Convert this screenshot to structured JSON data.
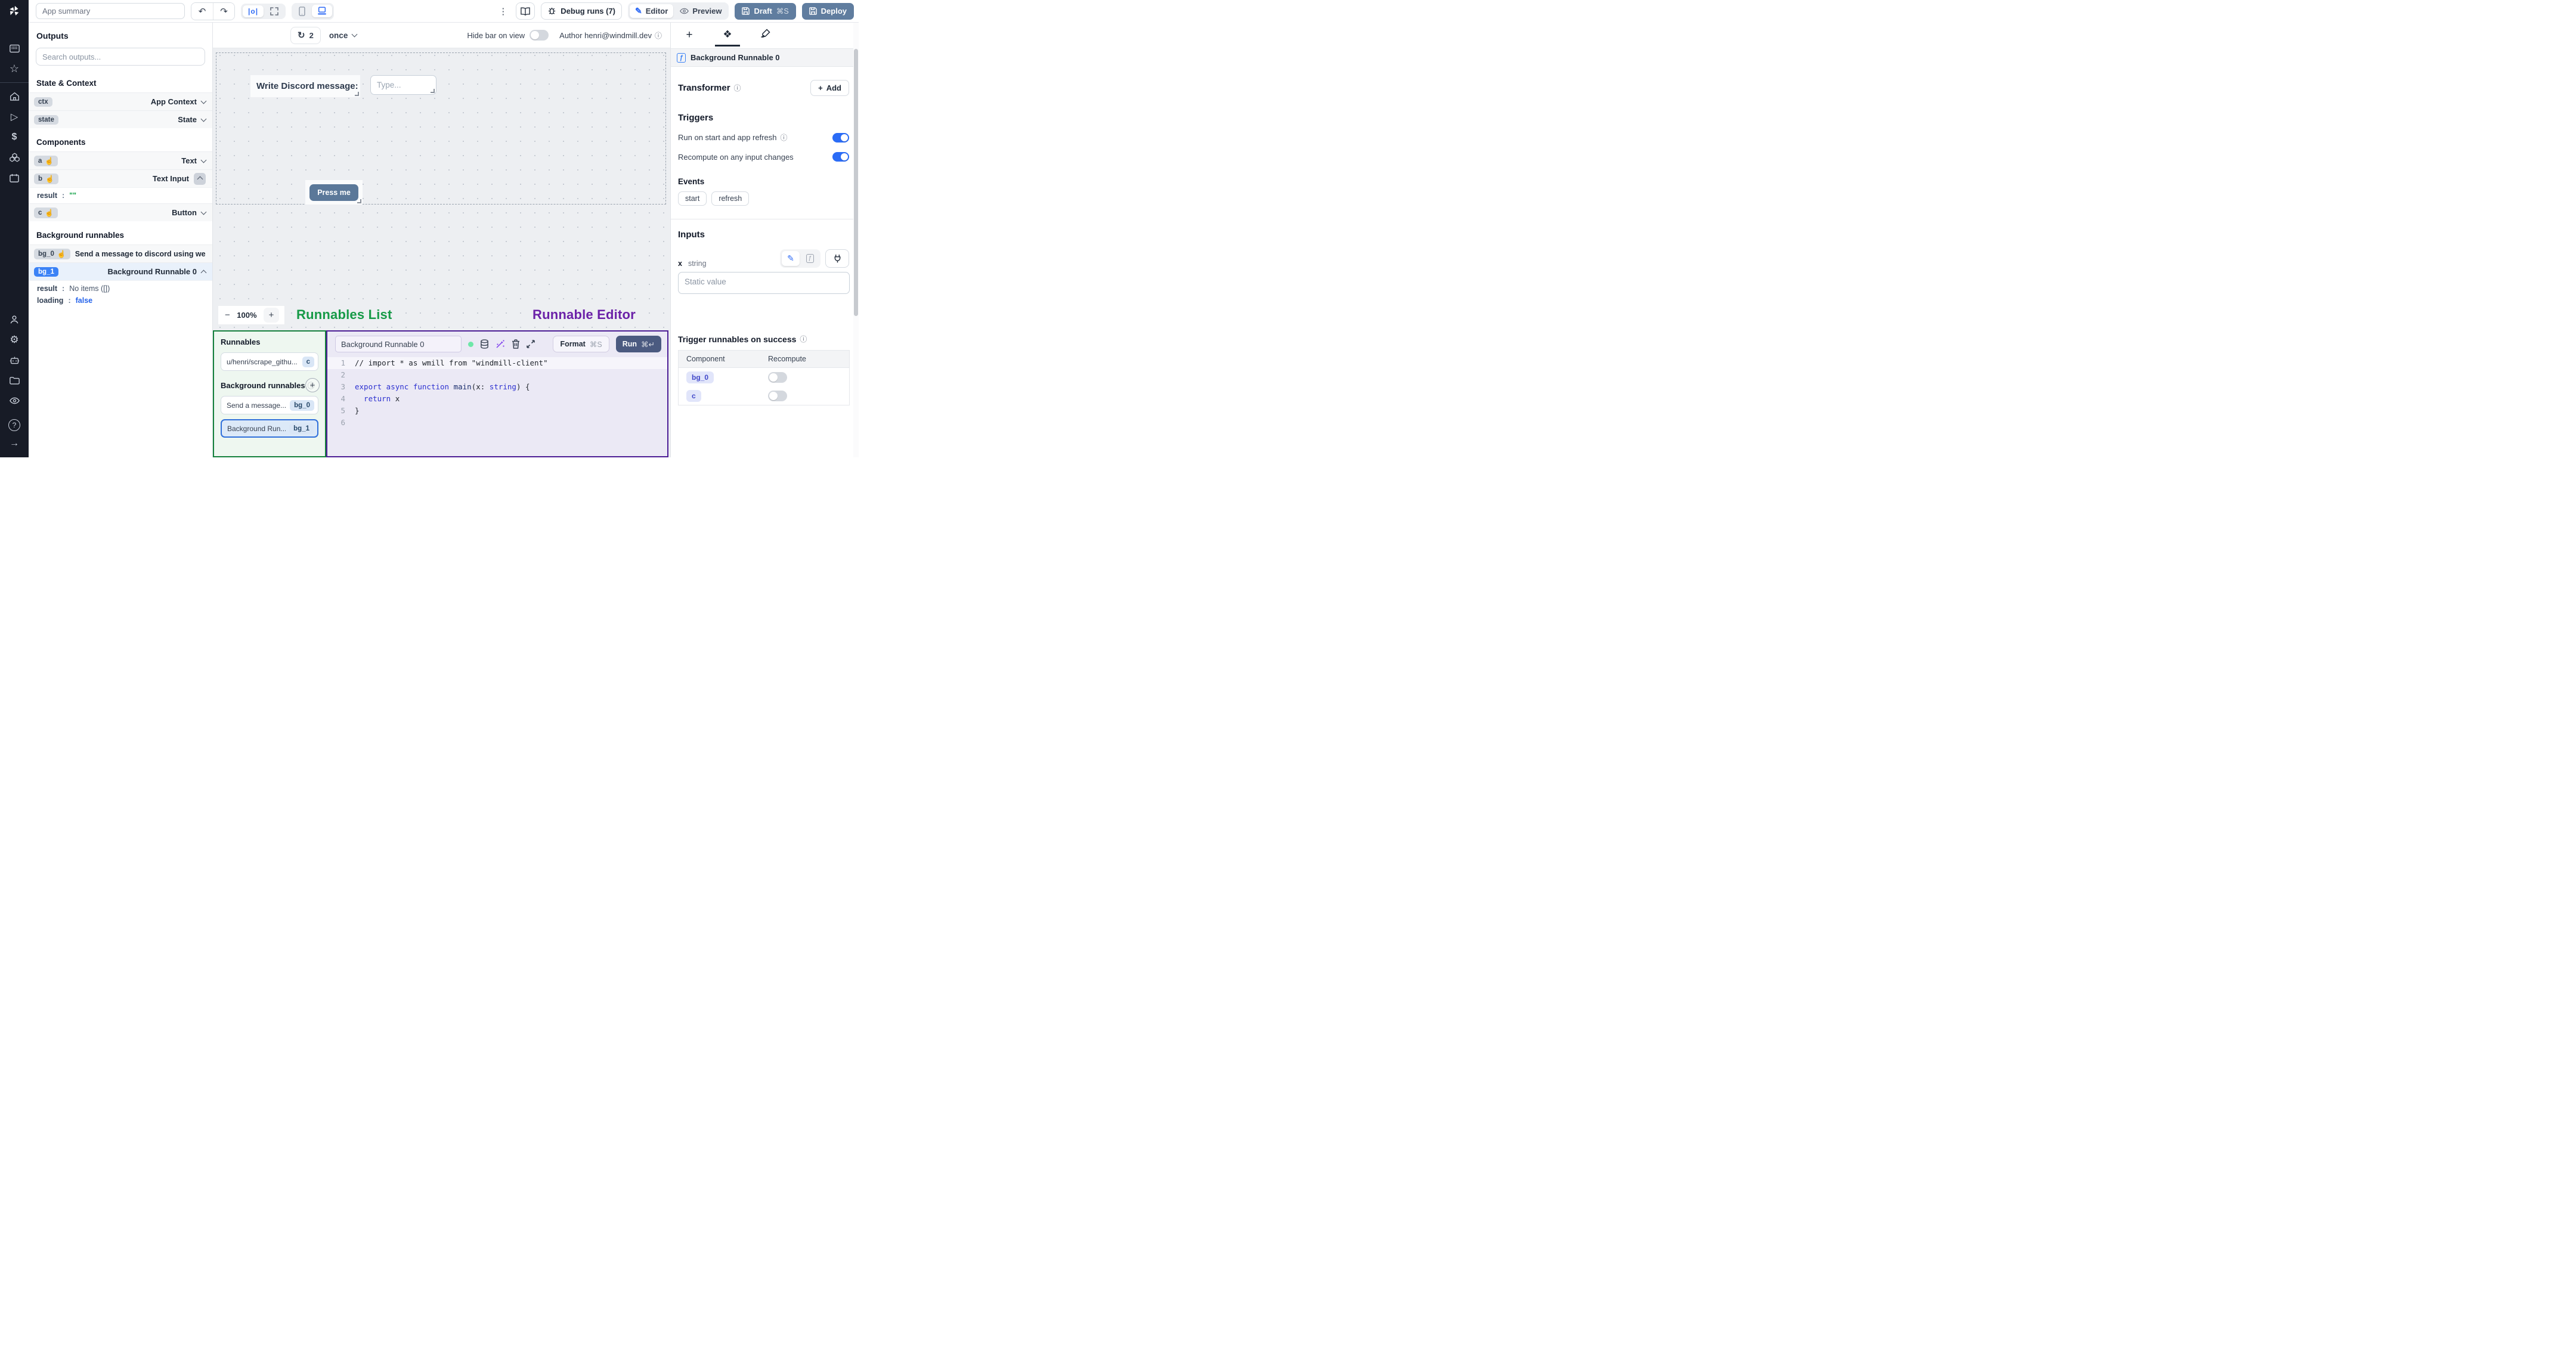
{
  "topbar": {
    "app_summary_placeholder": "App summary",
    "debug_runs": "Debug runs (7)",
    "editor": "Editor",
    "preview": "Preview",
    "draft": "Draft",
    "draft_kbd": "⌘S",
    "deploy": "Deploy"
  },
  "icons": {
    "undo": "↶",
    "redo": "↷",
    "center": "|o|",
    "kebab": "⋮",
    "refresh": "↻",
    "info": "ⓘ",
    "hand": "☝",
    "components": "❖",
    "pen": "✎",
    "fn": "ƒ",
    "plus": "+",
    "minus": "−",
    "gear": "⚙",
    "star": "☆",
    "play": "▷",
    "dollar": "$",
    "help": "?",
    "arrow_right": "→",
    "cmd_enter": "⌘↵"
  },
  "canvas_toolbar": {
    "refresh_count": "2",
    "interval": "once",
    "hide_bar_label": "Hide bar on view",
    "author": "Author henri@windmill.dev"
  },
  "canvas": {
    "text_component": "Write Discord message:",
    "input_placeholder": "Type...",
    "button_label": "Press me",
    "zoom_level": "100%"
  },
  "annotations": {
    "runnables_list": "Runnables List",
    "runnable_editor": "Runnable Editor",
    "green": "#169a47",
    "purple": "#6b21a8"
  },
  "outputs": {
    "title": "Outputs",
    "search_placeholder": "Search outputs...",
    "sections": {
      "state": "State & Context",
      "components": "Components",
      "background": "Background runnables"
    },
    "ctx": {
      "key": "ctx",
      "type": "App Context"
    },
    "state": {
      "key": "state",
      "type": "State"
    },
    "a": {
      "key": "a",
      "type": "Text"
    },
    "b": {
      "key": "b",
      "type": "Text Input"
    },
    "b_result": {
      "key": "result",
      "val": "\"\""
    },
    "c": {
      "key": "c",
      "type": "Button"
    },
    "bg0": {
      "key": "bg_0",
      "label": "Send a message to discord using webhoo"
    },
    "bg1": {
      "key": "bg_1",
      "label": "Background Runnable 0"
    },
    "bg1_result": {
      "key": "result",
      "val": "No items ([])"
    },
    "bg1_loading": {
      "key": "loading",
      "val": "false"
    }
  },
  "runnables_panel": {
    "title": "Runnables",
    "item1": {
      "label": "u/henri/scrape_githu...",
      "badge": "c"
    },
    "bg_section": "Background runnables",
    "item2": {
      "label": "Send a message...",
      "badge": "bg_0"
    },
    "item3": {
      "label": "Background Run...",
      "badge": "bg_1"
    }
  },
  "editor_panel": {
    "name": "Background Runnable 0",
    "format": "Format",
    "format_kbd": "⌘S",
    "run": "Run",
    "run_kbd": "⌘↵",
    "ln": [
      "1",
      "2",
      "3",
      "4",
      "5",
      "6"
    ],
    "code": {
      "l1": "// import * as wmill from \"windmill-client\"",
      "l3_export": "export",
      "l3_async": " async",
      "l3_function": " function",
      "l3_main": " main",
      "l3_p1": "(",
      "l3_x": "x",
      "l3_colon": ":",
      "l3_string": " string",
      "l3_close": ") {",
      "l4_return": "  return",
      "l4_x": " x",
      "l5": "}"
    }
  },
  "right_panel": {
    "selected_name": "Background Runnable 0",
    "transformer": {
      "title": "Transformer",
      "add": "Add"
    },
    "triggers": {
      "title": "Triggers",
      "row1": "Run on start and app refresh",
      "row2": "Recompute on any input changes"
    },
    "events": {
      "title": "Events",
      "pills": [
        "start",
        "refresh"
      ]
    },
    "inputs": {
      "title": "Inputs",
      "field": "x",
      "type": "string",
      "placeholder": "Static value"
    },
    "trigger_table": {
      "title": "Trigger runnables on success",
      "col1": "Component",
      "col2": "Recompute",
      "rows": [
        {
          "badge": "bg_0"
        },
        {
          "badge": "c"
        }
      ]
    }
  }
}
